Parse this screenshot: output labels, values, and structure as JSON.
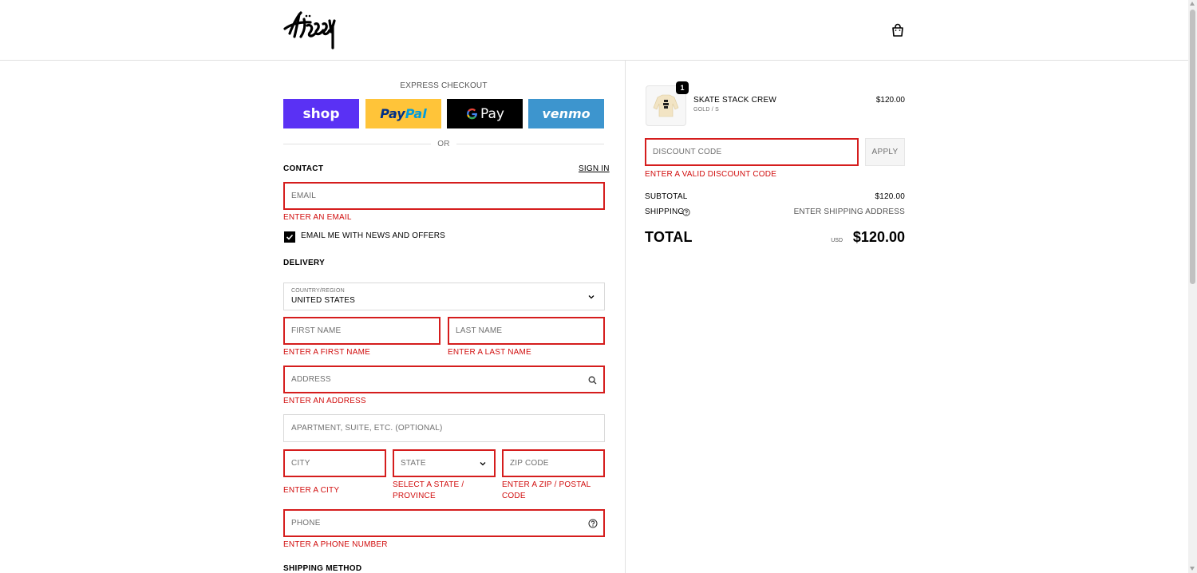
{
  "header": {
    "brand": "Stüssy",
    "cart_icon": "shopping-bag-icon"
  },
  "express": {
    "title": "EXPRESS CHECKOUT",
    "shop_label": "shop",
    "paypal_label": "PayPal",
    "gpay_label": "Pay",
    "venmo_label": "venmo",
    "or_label": "OR"
  },
  "contact": {
    "heading": "CONTACT",
    "sign_in": "SIGN IN",
    "email_placeholder": "EMAIL",
    "email_error": "ENTER AN EMAIL",
    "newsletter_label": "EMAIL ME WITH NEWS AND OFFERS",
    "newsletter_checked": true
  },
  "delivery": {
    "heading": "DELIVERY",
    "country_label": "COUNTRY/REGION",
    "country_value": "UNITED STATES",
    "first_name_placeholder": "FIRST NAME",
    "first_name_error": "ENTER A FIRST NAME",
    "last_name_placeholder": "LAST NAME",
    "last_name_error": "ENTER A LAST NAME",
    "address_placeholder": "ADDRESS",
    "address_error": "ENTER AN ADDRESS",
    "apartment_placeholder": "APARTMENT, SUITE, ETC. (OPTIONAL)",
    "city_placeholder": "CITY",
    "city_error": "ENTER A CITY",
    "state_placeholder": "STATE",
    "state_error_1": "SELECT A STATE /",
    "state_error_2": "PROVINCE",
    "zip_placeholder": "ZIP CODE",
    "zip_error_1": "ENTER A ZIP / POSTAL",
    "zip_error_2": "CODE",
    "phone_placeholder": "PHONE",
    "phone_error": "ENTER A PHONE NUMBER"
  },
  "shipping_method": {
    "heading": "SHIPPING METHOD"
  },
  "summary": {
    "item_name": "SKATE STACK CREW",
    "item_variant": "GOLD / S",
    "item_price": "$120.00",
    "item_qty": "1",
    "discount_placeholder": "DISCOUNT CODE",
    "discount_error": "ENTER A VALID DISCOUNT CODE",
    "apply_label": "APPLY",
    "subtotal_label": "SUBTOTAL",
    "subtotal_value": "$120.00",
    "shipping_label": "SHIPPING",
    "shipping_value": "ENTER SHIPPING ADDRESS",
    "total_label": "TOTAL",
    "currency": "USD",
    "total_value": "$120.00"
  },
  "colors": {
    "error_red": "#d51d1d",
    "shop_purple": "#5a31f4",
    "paypal_yellow": "#ffc439",
    "venmo_blue": "#3d95ce"
  }
}
